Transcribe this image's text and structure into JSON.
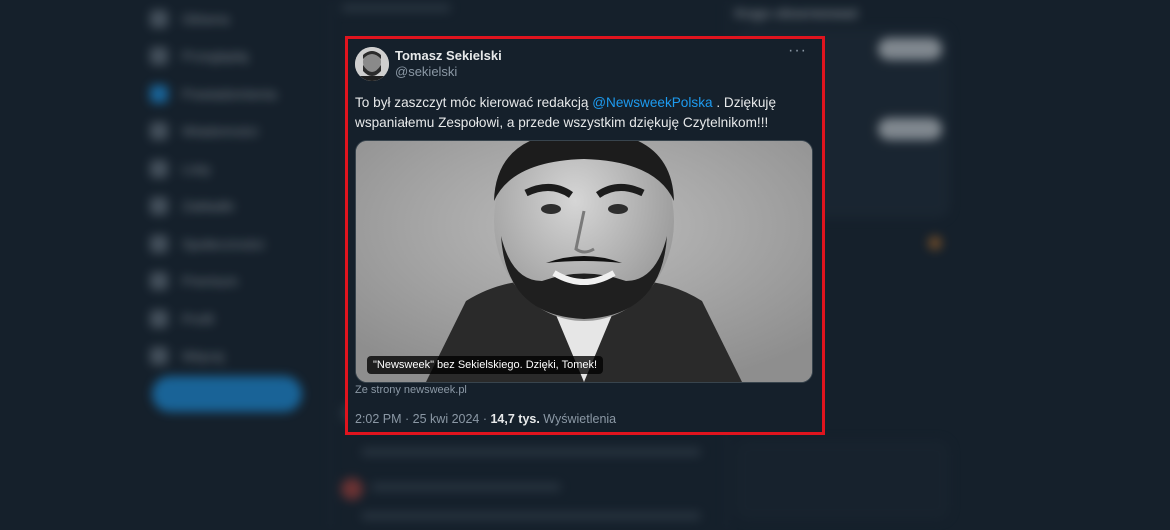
{
  "background": {
    "nav_items": [
      "Główna",
      "Przeglądaj",
      "Powiadomienia",
      "Wiadomości",
      "Listy",
      "Zakładki",
      "Społeczności",
      "Premium",
      "Profil",
      "Więcej"
    ],
    "post_button": "Opublikuj",
    "sidebar_title": "Kogo obserwować"
  },
  "tweet": {
    "author_name": "Tomasz Sekielski",
    "author_handle": "@sekielski",
    "more_label": "···",
    "text_before": "To był zaszczyt móc kierować redakcją ",
    "mention": "@NewsweekPolska",
    "text_after": " . Dziękuję wspaniałemu Zespołowi, a przede wszystkim dziękuję Czytelnikom!!!",
    "card_caption": "\"Newsweek\" bez Sekielskiego. Dzięki, Tomek!",
    "card_source": "Ze strony newsweek.pl",
    "time": "2:02 PM · 25 kwi 2024 · ",
    "views_count": "14,7 tys.",
    "views_label": " Wyświetlenia"
  },
  "colors": {
    "frame": "#e0141e",
    "accent": "#1d9bf0",
    "background": "#15202b"
  }
}
